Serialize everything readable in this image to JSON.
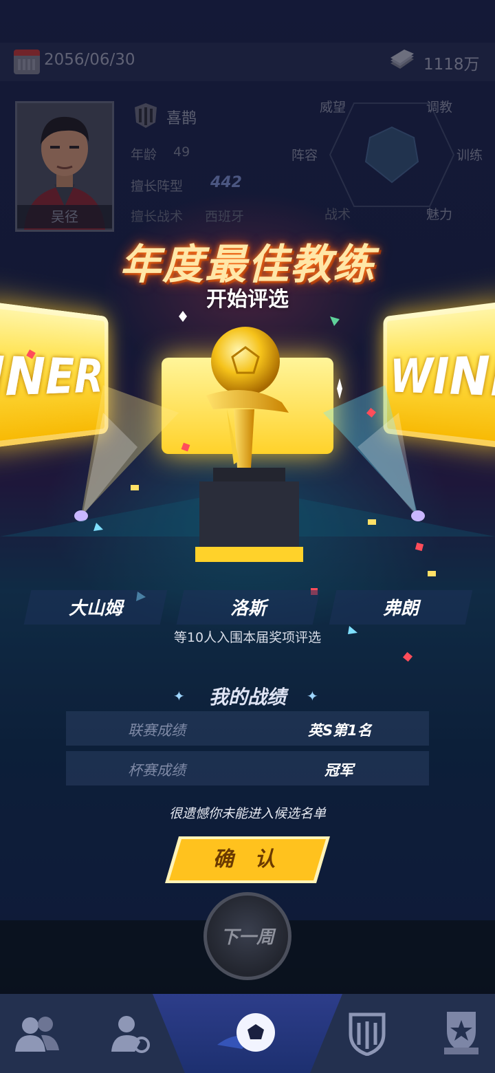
{
  "top_bar": {
    "date": "2056/06/30",
    "money": "1118万"
  },
  "coach": {
    "name": "吴径",
    "club": "喜鹊",
    "age_label": "年龄",
    "age": "49",
    "formation_label": "擅长阵型",
    "formation": "442",
    "tactic_label": "擅长战术",
    "tactic": "西班牙",
    "stats": [
      "威望",
      "调教",
      "阵容",
      "训练",
      "战术",
      "魅力"
    ]
  },
  "award": {
    "title": "年度最佳教练",
    "subtitle": "开始评选",
    "board_left": "INER",
    "board_right": "WINN",
    "candidates": [
      "大山姆",
      "洛斯",
      "弗朗"
    ],
    "candidate_note": "等10人入围本届奖项评选"
  },
  "record": {
    "title": "我的战绩",
    "rows": [
      {
        "label": "联赛成绩",
        "value": "英S第1名"
      },
      {
        "label": "杯赛成绩",
        "value": "冠军"
      }
    ],
    "result_text": "很遗憾你未能进入候选名单"
  },
  "confirm_label": "确 认",
  "next_week_label": "下一周",
  "nav": {
    "items": [
      "team-icon",
      "transfer-icon",
      "match-icon",
      "club-icon",
      "trophy-icon"
    ],
    "active_index": 2
  },
  "colors": {
    "gold": "#ffd22a",
    "accent_blue": "#2d3d8a",
    "title_glow": "#ff7a20"
  }
}
